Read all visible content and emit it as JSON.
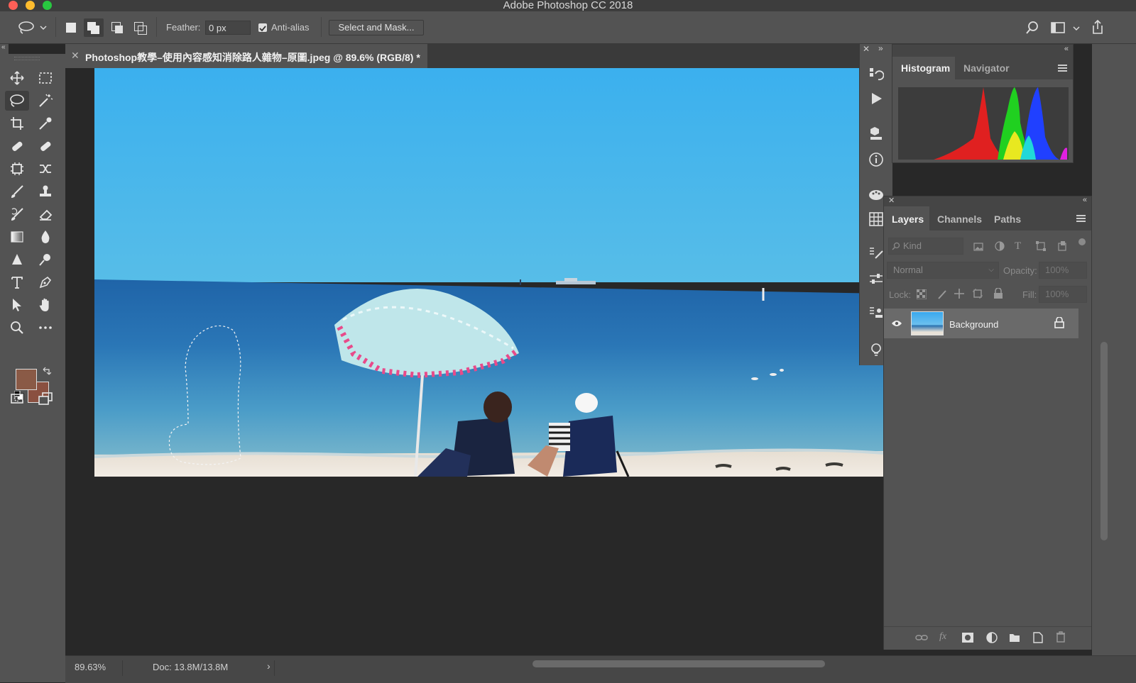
{
  "window": {
    "title": "Adobe Photoshop CC 2018"
  },
  "options_bar": {
    "feather_label": "Feather:",
    "feather_value": "0 px",
    "antialias_label": "Anti-alias",
    "antialias_checked": true,
    "select_mask_label": "Select and Mask..."
  },
  "document": {
    "tab_title": "Photoshop教學–使用內容感知消除路人雜物–原圖.jpeg @ 89.6% (RGB/8) *",
    "zoom": "89.63%",
    "doc_size": "Doc: 13.8M/13.8M"
  },
  "colors": {
    "foreground": "#8a5a46",
    "background": "#8a5040",
    "accent": "#1473e6"
  },
  "histogram_panel": {
    "tabs": [
      "Histogram",
      "Navigator"
    ],
    "active_tab": "Histogram"
  },
  "layers_panel": {
    "tabs": [
      "Layers",
      "Channels",
      "Paths"
    ],
    "active_tab": "Layers",
    "filter_placeholder": "Kind",
    "blend_mode": "Normal",
    "opacity_label": "Opacity:",
    "opacity_value": "100%",
    "lock_label": "Lock:",
    "fill_label": "Fill:",
    "fill_value": "100%",
    "layers": [
      {
        "name": "Background",
        "visible": true,
        "locked": true
      }
    ]
  }
}
